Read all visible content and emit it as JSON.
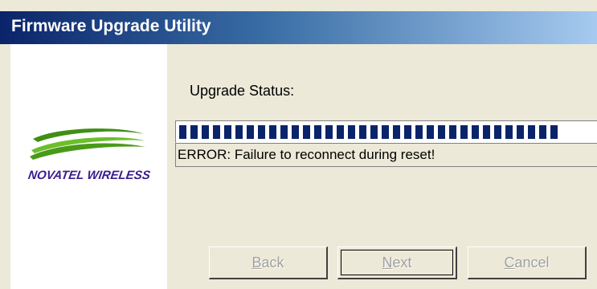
{
  "window": {
    "title": "Firmware Upgrade Utility"
  },
  "logo": {
    "brand_text": "NOVATEL WIRELESS",
    "swoosh_color": "#4a9a1a",
    "text_color": "#3b1c8f"
  },
  "status": {
    "label": "Upgrade Status:",
    "progress_fraction": 0.92,
    "progress_block_color": "#0a246a",
    "message": "ERROR: Failure to reconnect during reset!"
  },
  "buttons": {
    "back": {
      "access_key": "B",
      "rest": "ack",
      "enabled": false
    },
    "next": {
      "access_key": "N",
      "rest": "ext",
      "enabled": false
    },
    "cancel": {
      "access_key": "C",
      "rest": "ancel",
      "enabled": false
    }
  }
}
